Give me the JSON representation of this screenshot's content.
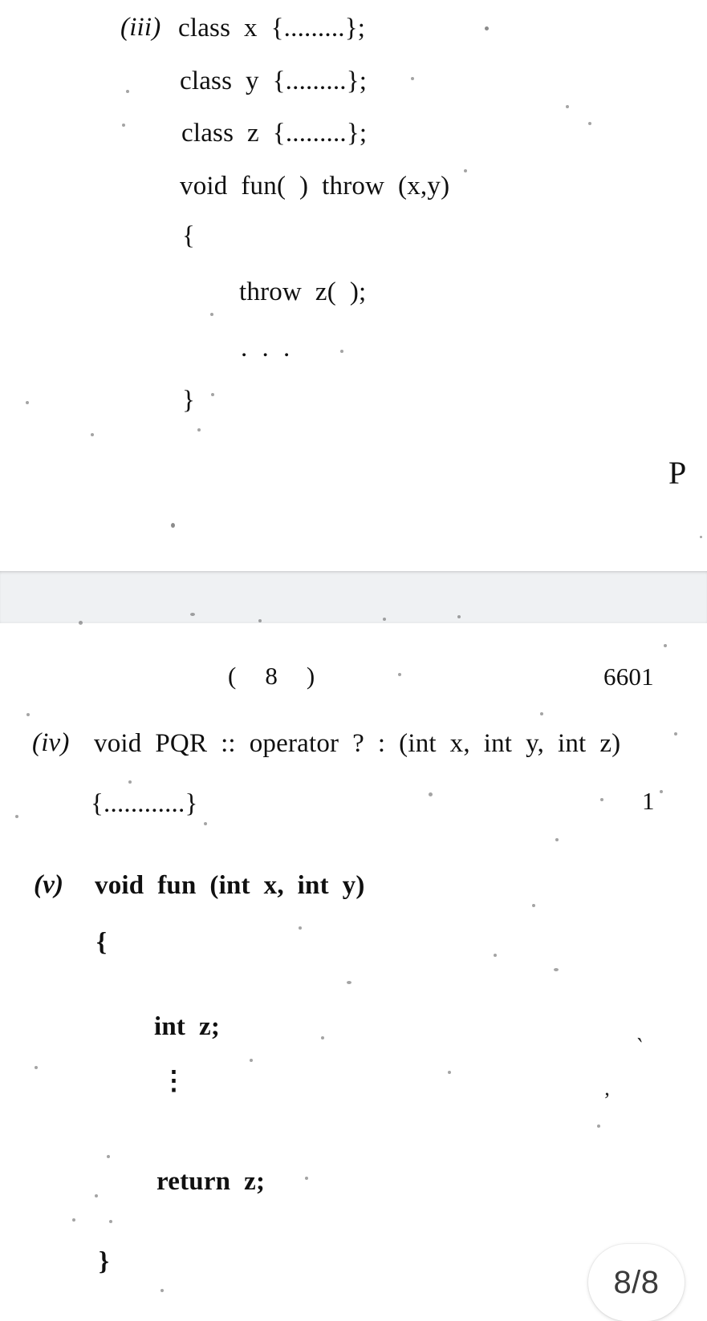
{
  "document": {
    "type": "scanned-exam-paper",
    "page_indicator": "8/8",
    "page_header_center": "(    8    )",
    "page_header_code": "6601",
    "edge_cut_letter": "P"
  },
  "upper_page": {
    "item_label": "(iii)",
    "lines": [
      "class  x  {.........};",
      "class  y  {.........};",
      "class  z  {.........};",
      "void  fun(  )  throw  (x,y)",
      "{",
      "throw  z(  );",
      ". . .",
      "}"
    ]
  },
  "lower_page": {
    "items": [
      {
        "label": "(iv)",
        "lines": [
          "void  PQR  ::  operator  ?  :  (int  x,  int  y,  int  z)",
          "{............}"
        ],
        "marks": "1"
      },
      {
        "label": "(v)",
        "lines": [
          "void  fun  (int  x,  int  y)",
          "{",
          "int  z;",
          "⋮",
          "return  z;",
          "}"
        ]
      }
    ]
  },
  "colors": {
    "page_background": "#ffffff",
    "page_gap": "#eff1f3",
    "ink": "#101010",
    "pill_text": "#3b3b3b"
  }
}
